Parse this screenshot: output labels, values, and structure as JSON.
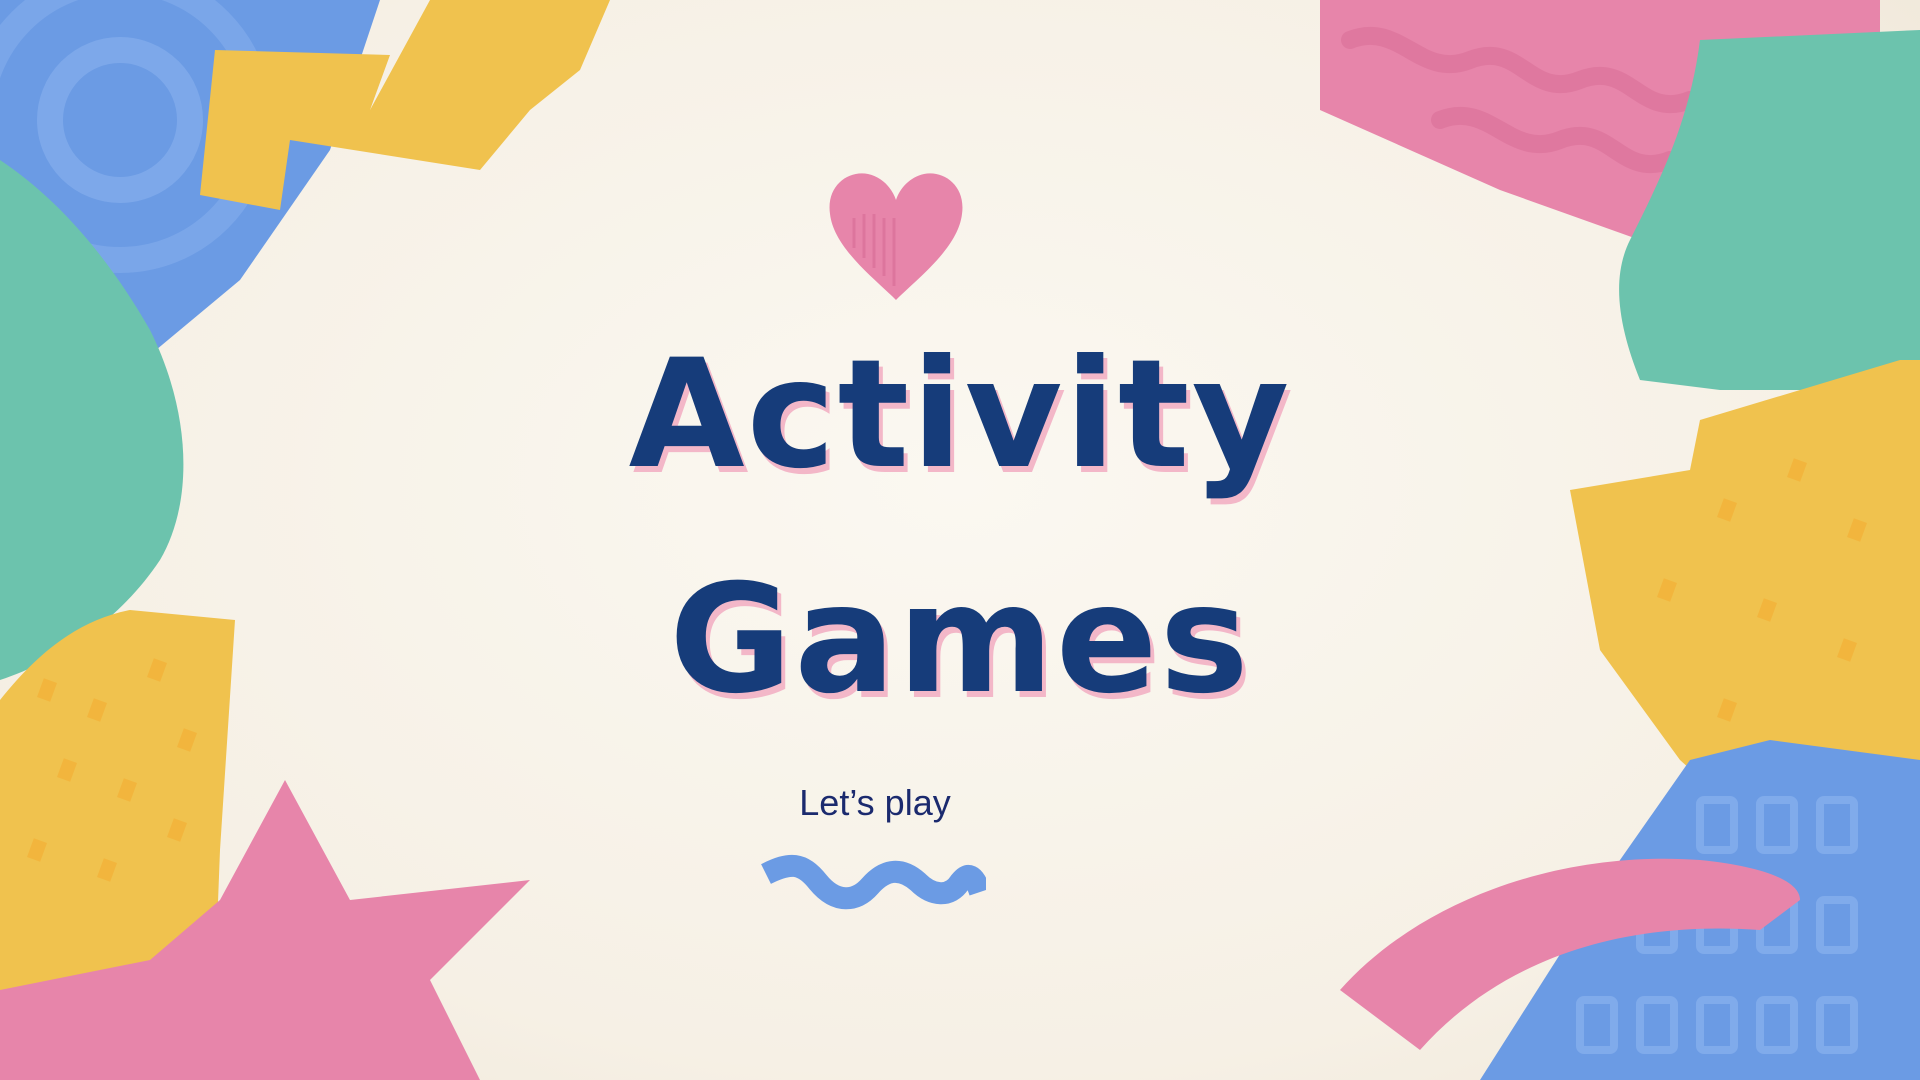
{
  "slide": {
    "title_line1": "Activity",
    "title_line2": "Games",
    "subtitle": "Let’s play"
  },
  "colors": {
    "background": "#f8f3ea",
    "title": "#163c7a",
    "title_shadow": "#f3b7c8",
    "subtitle": "#1b2a6e",
    "pink": "#e785aa",
    "yellow": "#f0c24e",
    "blue": "#6b9be4",
    "teal": "#6cc3ad"
  },
  "icons": {
    "top": "heart-icon",
    "bottom": "wavy-line-icon"
  }
}
